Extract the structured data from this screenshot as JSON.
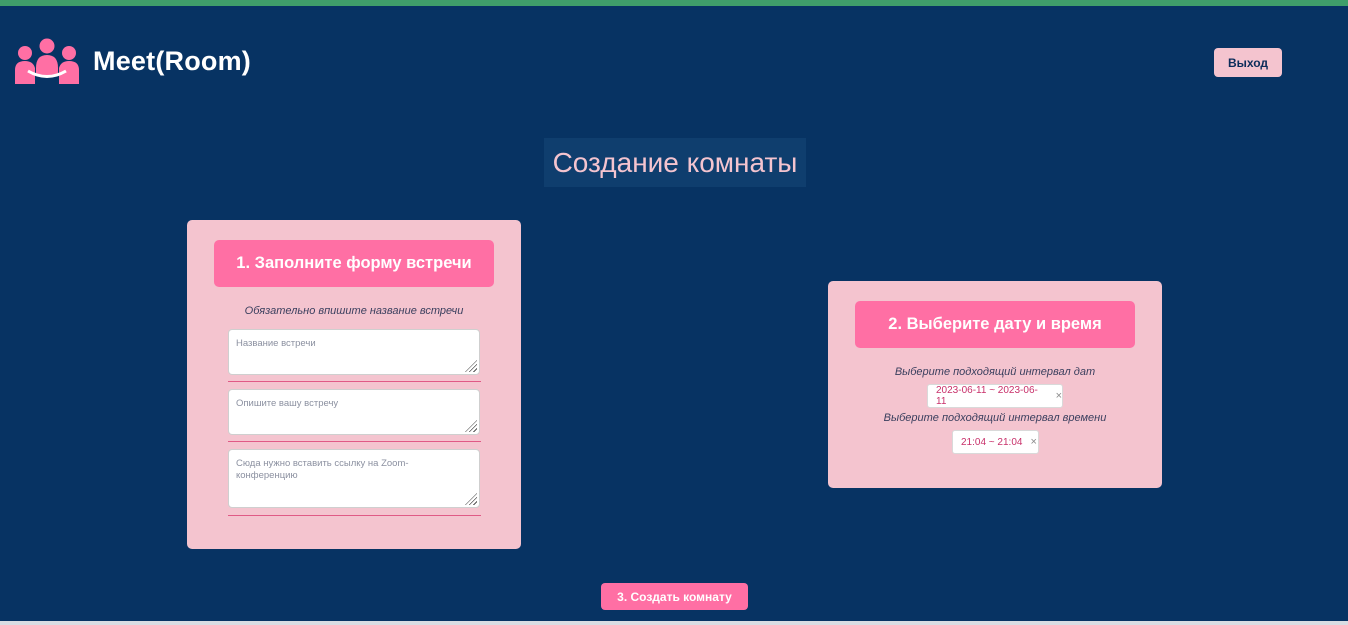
{
  "header": {
    "logo_icon": "people-group-icon",
    "brand": "Meet(Room)",
    "logout_label": "Выход"
  },
  "page": {
    "title": "Создание комнаты"
  },
  "form_card": {
    "heading": "1. Заполните форму встречи",
    "hint": "Обязательно впишите название встречи",
    "fields": [
      {
        "placeholder": "Название встречи",
        "value": ""
      },
      {
        "placeholder": "Опишите вашу встречу",
        "value": ""
      },
      {
        "placeholder": "Сюда нужно вставить ссылку на Zoom-конференцию",
        "value": ""
      }
    ]
  },
  "datetime_card": {
    "heading": "2. Выберите дату и время",
    "date_hint": "Выберите подходящий интервал дат",
    "date_range": "2023-06-11 ~ 2023-06-11",
    "time_hint": "Выберите подходящий интервал времени",
    "time_range": "21:04 ~ 21:04",
    "clear_glyph": "×"
  },
  "actions": {
    "create_label": "3. Создать комнату"
  },
  "colors": {
    "background": "#073363",
    "accent_pink": "#ff6fa4",
    "card_pink": "#f4c4cf",
    "top_line": "#3f9e6a"
  }
}
